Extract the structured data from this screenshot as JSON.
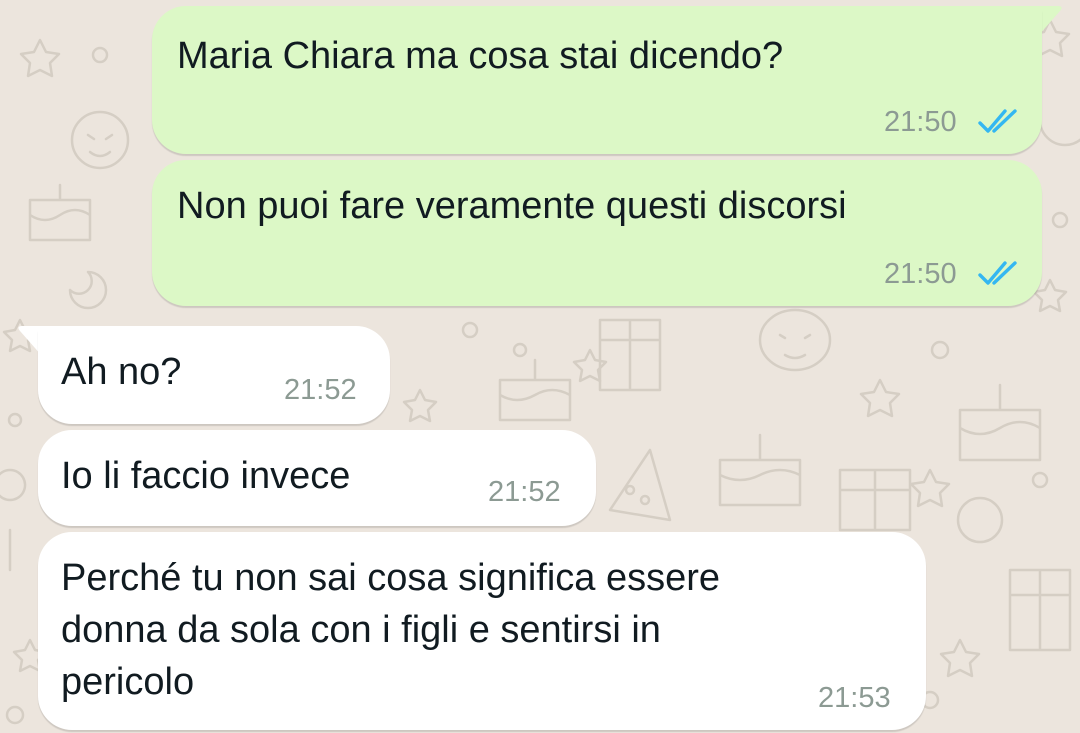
{
  "colors": {
    "outgoing_bubble": "#dcf8c6",
    "incoming_bubble": "#ffffff",
    "wallpaper": "#ece5dd",
    "read_ticks": "#34b7f1",
    "timestamp": "#8c9a93"
  },
  "messages": [
    {
      "direction": "outgoing",
      "text": "Maria Chiara ma cosa stai dicendo?",
      "time": "21:50",
      "status": "read",
      "status_icon": "double-check-icon"
    },
    {
      "direction": "outgoing",
      "text": "Non puoi fare veramente questi discorsi",
      "time": "21:50",
      "status": "read",
      "status_icon": "double-check-icon"
    },
    {
      "direction": "incoming",
      "text": "Ah no?",
      "time": "21:52"
    },
    {
      "direction": "incoming",
      "text": "Io li faccio invece",
      "time": "21:52"
    },
    {
      "direction": "incoming",
      "lines": [
        "Perché tu non sai cosa significa essere",
        "donna da sola con i figli e sentirsi in",
        "pericolo"
      ],
      "time": "21:53"
    }
  ]
}
